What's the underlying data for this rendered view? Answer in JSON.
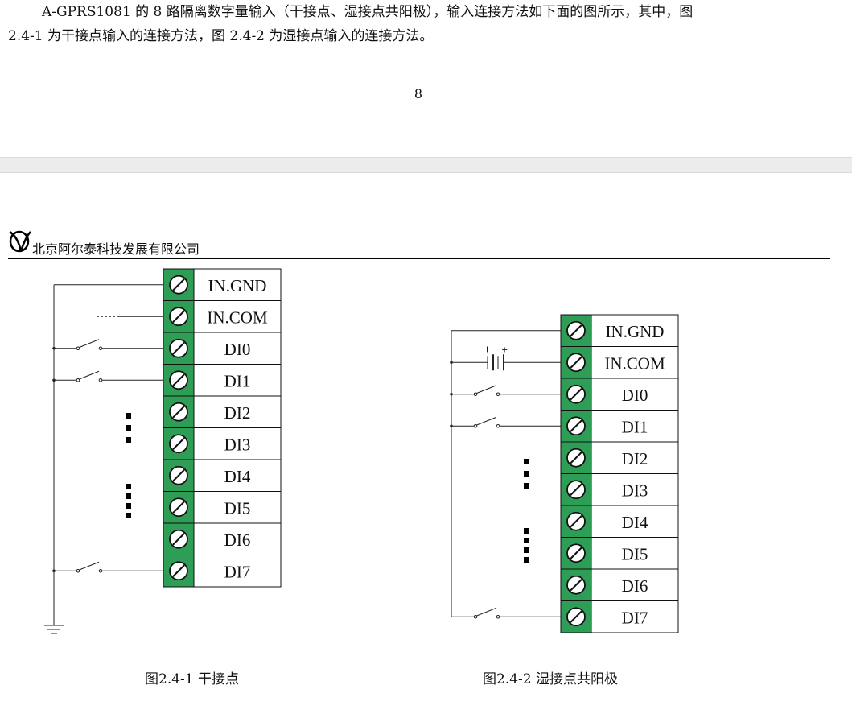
{
  "paragraph": {
    "line1": "A-GPRS1081 的 8 路隔离数字量输入（干接点、湿接点共阳极），输入连接方法如下面的图所示，其中，图",
    "line2": "2.4-1 为干接点输入的连接方法，图 2.4-2 为湿接点输入的连接方法。"
  },
  "page_number": "8",
  "header": {
    "company": "北京阿尔泰科技发展有限公司"
  },
  "figure1": {
    "terminals": [
      "IN.GND",
      "IN.COM",
      "DI0",
      "DI1",
      "DI2",
      "DI3",
      "DI4",
      "DI5",
      "DI6",
      "DI7"
    ],
    "caption": "图2.4-1  干接点"
  },
  "figure2": {
    "terminals": [
      "IN.GND",
      "IN.COM",
      "DI0",
      "DI1",
      "DI2",
      "DI3",
      "DI4",
      "DI5",
      "DI6",
      "DI7"
    ],
    "battery_minus": "I",
    "battery_plus": "+",
    "caption": "图2.4-2  湿接点共阳极"
  },
  "colors": {
    "terminal_green": "#2e9d55",
    "line": "#222222"
  }
}
